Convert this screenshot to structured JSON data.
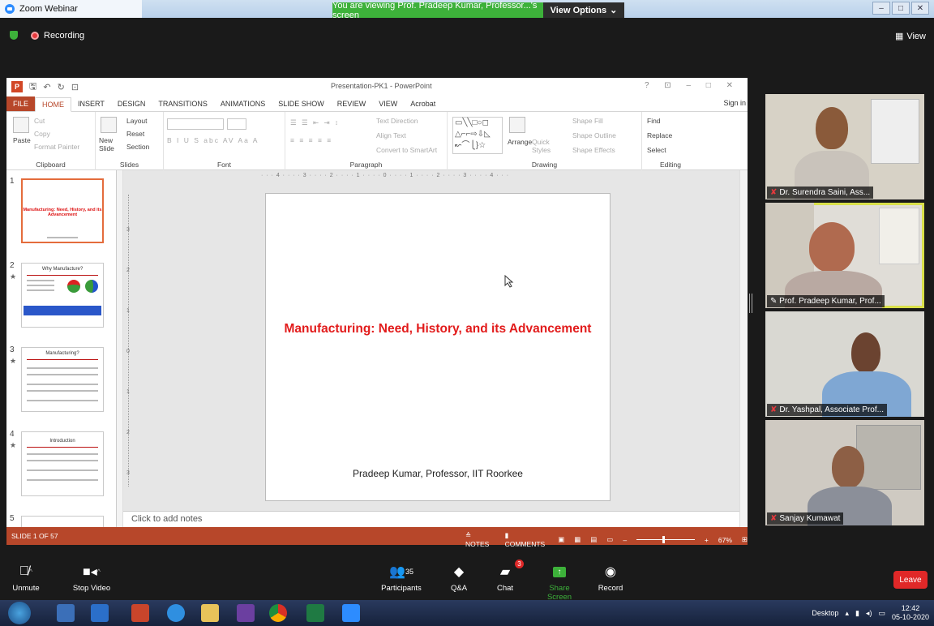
{
  "zoom": {
    "app_title": "Zoom Webinar",
    "share_banner": "You are viewing Prof. Pradeep Kumar, Professor...'s screen",
    "view_options": "View Options",
    "recording": "Recording",
    "view": "View"
  },
  "ppt": {
    "doc_title": "Presentation-PK1 - PowerPoint",
    "tabs": [
      "FILE",
      "HOME",
      "INSERT",
      "DESIGN",
      "TRANSITIONS",
      "ANIMATIONS",
      "SLIDE SHOW",
      "REVIEW",
      "VIEW",
      "Acrobat"
    ],
    "sign_in": "Sign in",
    "ribbon": {
      "clipboard": {
        "label": "Clipboard",
        "paste": "Paste",
        "cut": "Cut",
        "copy": "Copy",
        "format_painter": "Format Painter"
      },
      "slides": {
        "label": "Slides",
        "new_slide": "New Slide",
        "layout": "Layout",
        "reset": "Reset",
        "section": "Section"
      },
      "font": {
        "label": "Font"
      },
      "paragraph": {
        "label": "Paragraph",
        "text_direction": "Text Direction",
        "align_text": "Align Text",
        "convert": "Convert to SmartArt"
      },
      "drawing": {
        "label": "Drawing",
        "arrange": "Arrange",
        "quick_styles": "Quick Styles",
        "shape_fill": "Shape Fill",
        "shape_outline": "Shape Outline",
        "shape_effects": "Shape Effects"
      },
      "editing": {
        "label": "Editing",
        "find": "Find",
        "replace": "Replace",
        "select": "Select"
      }
    },
    "thumbnails": [
      {
        "num": "1",
        "title": "Manufacturing: Need, History, and its Advancement",
        "active": true
      },
      {
        "num": "2",
        "title": "Why Manufacture?",
        "active": false
      },
      {
        "num": "3",
        "title": "Manufacturing?",
        "active": false
      },
      {
        "num": "4",
        "title": "Introduction",
        "active": false
      },
      {
        "num": "5",
        "title": "",
        "active": false
      }
    ],
    "slide": {
      "title": "Manufacturing: Need, History, and its Advancement",
      "subtitle": "Pradeep Kumar, Professor, IIT Roorkee"
    },
    "notes_placeholder": "Click to add notes",
    "ruler_text": "· · · 4 · · · · 3 · · · · 2 · · · · 1 · · · · 0 · · · · 1 · · · · 2 · · · · 3 · · · · 4 · · ·",
    "status": {
      "slide_counter": "SLIDE 1 OF 57",
      "notes": "NOTES",
      "comments": "COMMENTS",
      "zoom_level": "67%"
    }
  },
  "participants": [
    {
      "name": "Dr. Surendra Saini, Ass..."
    },
    {
      "name": "Prof. Pradeep Kumar, Prof..."
    },
    {
      "name": "Dr. Yashpal, Associate Prof..."
    },
    {
      "name": "Sanjay Kumawat"
    }
  ],
  "toolbar": {
    "unmute": "Unmute",
    "stop_video": "Stop Video",
    "participants": "Participants",
    "participant_count": "35",
    "qa": "Q&A",
    "chat": "Chat",
    "chat_badge": "3",
    "share_screen": "Share Screen",
    "record": "Record",
    "leave": "Leave"
  },
  "taskbar": {
    "desktop": "Desktop",
    "time": "12:42",
    "date": "05-10-2020"
  }
}
